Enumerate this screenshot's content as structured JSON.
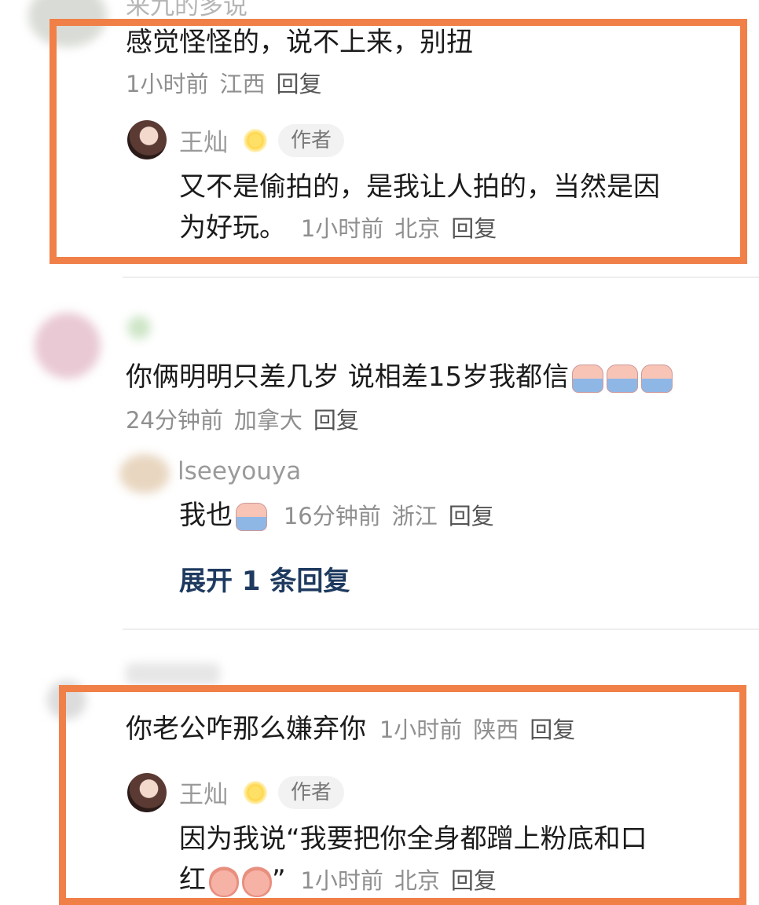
{
  "thread1": {
    "top_username_partial": "来九的多说",
    "comment": "感觉怪怪的，说不上来，别扭",
    "meta": {
      "time": "1小时前",
      "location": "江西",
      "reply": "回复"
    },
    "author_reply": {
      "username": "王灿",
      "badge": "作者",
      "text_line1": "又不是偷拍的，是我让人拍的，当然是因",
      "text_line2": "为好玩。",
      "meta": {
        "time": "1小时前",
        "location": "北京",
        "reply": "回复"
      }
    }
  },
  "thread2": {
    "comment": "你俩明明只差几岁 说相差15岁我都信",
    "emoji_count": 3,
    "meta": {
      "time": "24分钟前",
      "location": "加拿大",
      "reply": "回复"
    },
    "sub_reply": {
      "username": "lseeyouya",
      "text": "我也",
      "meta": {
        "time": "16分钟前",
        "location": "浙江",
        "reply": "回复"
      }
    },
    "expand_label": "展开 1 条回复"
  },
  "thread3": {
    "comment": "你老公咋那么嫌弃你",
    "meta": {
      "time": "1小时前",
      "location": "陕西",
      "reply": "回复"
    },
    "author_reply": {
      "username": "王灿",
      "badge": "作者",
      "text_line1": "因为我说“我要把你全身都蹭上粉底和口",
      "text_line2_prefix": "红",
      "text_line2_suffix": "”",
      "meta": {
        "time": "1小时前",
        "location": "北京",
        "reply": "回复"
      }
    }
  },
  "colors": {
    "highlight": "#f08048",
    "meta_gray": "#8f8f8f",
    "expand_link": "#1e3a5f"
  }
}
